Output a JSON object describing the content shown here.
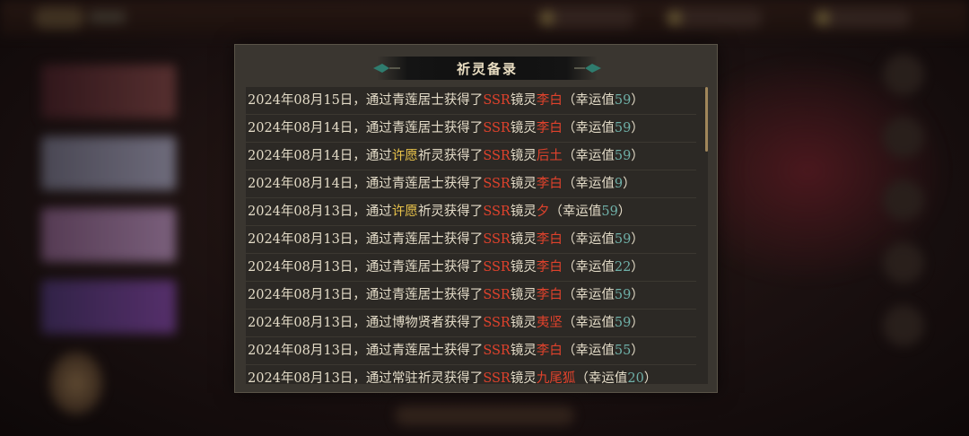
{
  "dialog": {
    "title": "祈灵备录",
    "rows": [
      {
        "date": "2024年08月15日，",
        "via": "通过",
        "source": "青莲居士",
        "source_hl": false,
        "got": "获得了",
        "rarity": "SSR",
        "kind": "镜灵",
        "name": "李白",
        "luck_prefix": "（幸运值",
        "luck": "59",
        "luck_suffix": "）"
      },
      {
        "date": "2024年08月14日，",
        "via": "通过",
        "source": "青莲居士",
        "source_hl": false,
        "got": "获得了",
        "rarity": "SSR",
        "kind": "镜灵",
        "name": "李白",
        "luck_prefix": "（幸运值",
        "luck": "59",
        "luck_suffix": "）"
      },
      {
        "date": "2024年08月14日，",
        "via": "通过",
        "source": "许愿",
        "source_hl": true,
        "got": "祈灵获得了",
        "rarity": "SSR",
        "kind": "镜灵",
        "name": "后土",
        "luck_prefix": "（幸运值",
        "luck": "59",
        "luck_suffix": "）"
      },
      {
        "date": "2024年08月14日，",
        "via": "通过",
        "source": "青莲居士",
        "source_hl": false,
        "got": "获得了",
        "rarity": "SSR",
        "kind": "镜灵",
        "name": "李白",
        "luck_prefix": "（幸运值",
        "luck": "9",
        "luck_suffix": "）"
      },
      {
        "date": "2024年08月13日，",
        "via": "通过",
        "source": "许愿",
        "source_hl": true,
        "got": "祈灵获得了",
        "rarity": "SSR",
        "kind": "镜灵",
        "name": "夕",
        "luck_prefix": "（幸运值",
        "luck": "59",
        "luck_suffix": "）"
      },
      {
        "date": "2024年08月13日，",
        "via": "通过",
        "source": "青莲居士",
        "source_hl": false,
        "got": "获得了",
        "rarity": "SSR",
        "kind": "镜灵",
        "name": "李白",
        "luck_prefix": "（幸运值",
        "luck": "59",
        "luck_suffix": "）"
      },
      {
        "date": "2024年08月13日，",
        "via": "通过",
        "source": "青莲居士",
        "source_hl": false,
        "got": "获得了",
        "rarity": "SSR",
        "kind": "镜灵",
        "name": "李白",
        "luck_prefix": "（幸运值",
        "luck": "22",
        "luck_suffix": "）"
      },
      {
        "date": "2024年08月13日，",
        "via": "通过",
        "source": "青莲居士",
        "source_hl": false,
        "got": "获得了",
        "rarity": "SSR",
        "kind": "镜灵",
        "name": "李白",
        "luck_prefix": "（幸运值",
        "luck": "59",
        "luck_suffix": "）"
      },
      {
        "date": "2024年08月13日，",
        "via": "通过",
        "source": "博物贤者",
        "source_hl": false,
        "got": "获得了",
        "rarity": "SSR",
        "kind": "镜灵",
        "name": "夷坚",
        "luck_prefix": "（幸运值",
        "luck": "59",
        "luck_suffix": "）"
      },
      {
        "date": "2024年08月13日，",
        "via": "通过",
        "source": "青莲居士",
        "source_hl": false,
        "got": "获得了",
        "rarity": "SSR",
        "kind": "镜灵",
        "name": "李白",
        "luck_prefix": "（幸运值",
        "luck": "55",
        "luck_suffix": "）"
      },
      {
        "date": "2024年08月13日，",
        "via": "通过",
        "source": "常驻",
        "source_hl": false,
        "got": "祈灵获得了",
        "rarity": "SSR",
        "kind": "镜灵",
        "name": "九尾狐",
        "luck_prefix": "（幸运值",
        "luck": "20",
        "luck_suffix": "）"
      }
    ]
  },
  "colors": {
    "highlight_yellow": "#e8c24a",
    "rarity_red": "#e0422c",
    "luck_green": "#6fb0a8"
  }
}
